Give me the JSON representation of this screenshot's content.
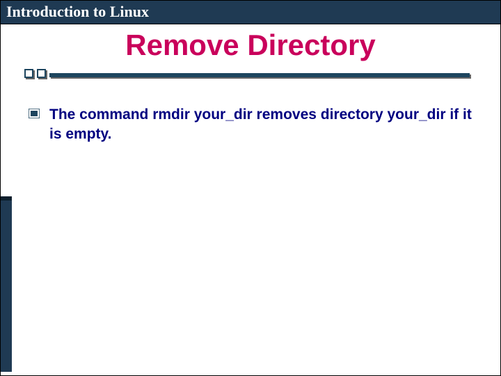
{
  "header": {
    "course_title": "Introduction to Linux"
  },
  "slide": {
    "title": "Remove Directory",
    "bullets": [
      {
        "text": "The command rmdir your_dir removes directory your_dir if it is empty."
      }
    ]
  },
  "colors": {
    "header_bg": "#1f3a53",
    "title": "#c9005b",
    "body_text": "#000080",
    "accent_line": "#1d455e"
  }
}
